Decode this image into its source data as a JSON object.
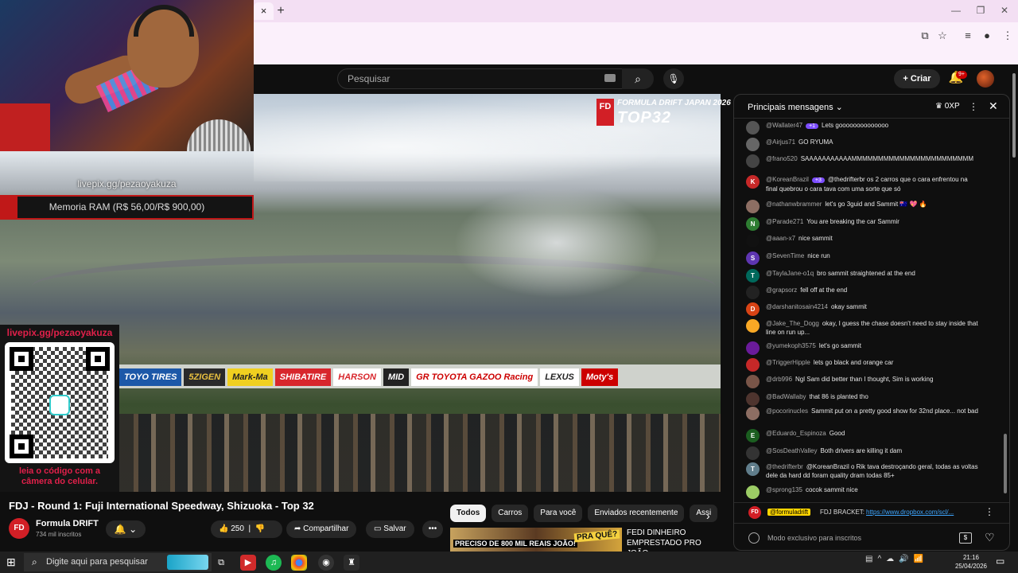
{
  "browser": {
    "tab_close": "×",
    "new_tab": "+",
    "min": "—",
    "max": "❐",
    "close": "✕"
  },
  "yt_header": {
    "search_placeholder": "Pesquisar",
    "create_label": "Criar",
    "bell_badge": "9+"
  },
  "video": {
    "overlay_brand": "FORMULA DRIFT JAPAN 2026",
    "overlay_tag": "TOP32",
    "fd_badge": "FD",
    "livepix_top": "livepix.gg/pezaoyakuza",
    "goal": "Memoria RAM (R$ 56,00/R$ 900,00)",
    "goal_progress": 0.062,
    "livepix_qr_label": "livepix.gg/pezaoyakuza",
    "qr_caption": "leia o código com a câmera do celular.",
    "banners": [
      "TOYO TIRES",
      "5ZIGEN",
      "Mark-Ma",
      "SHIBATIRE",
      "HARSON",
      "MID",
      "GR TOYOTA GAZOO Racing",
      "LEXUS",
      "Moty's"
    ]
  },
  "below": {
    "title": "FDJ - Round 1: Fuji International Speedway, Shizuoka - Top 32",
    "channel": "Formula DRIFT",
    "channel_avatar": "FD",
    "subs": "734 mil inscritos",
    "likes": "250",
    "share": "Compartilhar",
    "save": "Salvar",
    "more": "•••"
  },
  "chips": [
    "Todos",
    "Carros",
    "Para você",
    "Enviados recentemente",
    "Assi"
  ],
  "recommended": {
    "thumb_text": "PRECISO DE 800 MIL REAIS JOÃO!",
    "thumb_text2": "PRA QUÊ?",
    "title": "FEDI DINHEIRO EMPRESTADO PRO JOÃO ..."
  },
  "chat": {
    "title": "Principais mensagens",
    "xp": "0XP",
    "messages": [
      {
        "author": "@Wallater47",
        "badge": "+1",
        "text": "Lets goooooooooooooo",
        "color": "#555"
      },
      {
        "author": "@Airjus71",
        "text": "GO RYUMA",
        "color": "#666"
      },
      {
        "author": "@frano520",
        "text": "SAAAAAAAAAAAMMMMMMMMMMMMMMMMMMMMMMM",
        "color": "#444"
      },
      {
        "author": "@KoreanBrazil",
        "badge": "+3",
        "text": "@thedrifterbr os 2 carros que o cara enfrentou na final quebrou o cara tava com uma sorte que só",
        "color": "#c62828",
        "initial": "K"
      },
      {
        "author": "@nathanwbrammer",
        "text": "let's go 3guid and Sammit 🇦🇺 💖 🔥",
        "color": "#8d6e63"
      },
      {
        "author": "@Parade271",
        "text": "You are breaking the car Sammir",
        "color": "#2e7d32",
        "initial": "N"
      },
      {
        "author": "@aaan-x7",
        "text": "nice sammit",
        "color": "#111"
      },
      {
        "author": "@SevenTime",
        "text": "nice run",
        "color": "#5e35b1",
        "initial": "S"
      },
      {
        "author": "@TaylaJane-o1q",
        "text": "bro sammit straightened at the end",
        "color": "#00695c",
        "initial": "T"
      },
      {
        "author": "@grapsorz",
        "text": "fell off at the end",
        "color": "#222"
      },
      {
        "author": "@darshanitosain4214",
        "text": "okay sammit",
        "color": "#d84315",
        "initial": "D"
      },
      {
        "author": "@Jake_The_Dogg",
        "text": "okay, I guess the chase doesn't need to stay inside that line on run up...",
        "color": "#f9a825"
      },
      {
        "author": "@yumekoph3575",
        "text": "let's go sammit",
        "color": "#6a1b9a"
      },
      {
        "author": "@TriggerHipple",
        "text": "lets go black and orange car",
        "color": "#c62828"
      },
      {
        "author": "@drb996",
        "text": "Ngl Sam did better than I thought, Sim is working",
        "color": "#795548"
      },
      {
        "author": "@BadWallaby",
        "text": "that 86 is planted tho",
        "color": "#4e342e"
      },
      {
        "author": "@pocorinucles",
        "text": "Sammit put on a pretty good show for 32nd place... not bad",
        "color": "#8d6e63"
      },
      {
        "author": "@Eduardo_Espinoza",
        "text": "Good",
        "color": "#1b5e20",
        "initial": "E"
      },
      {
        "author": "@SosDeathValley",
        "text": "Both drivers are killing it dam",
        "color": "#333"
      },
      {
        "author": "@thedrifterbr",
        "text": "@KoreanBrazil o Rik tava destroçando geral, todas as voltas dele da hard dd foram quality dram todas 85+",
        "color": "#607d8b",
        "initial": "T"
      },
      {
        "author": "@sprong135",
        "text": "cocok sammit nice",
        "color": "#9ccc65"
      }
    ],
    "pinned_name": "@formuladrift",
    "pinned_text": "FDJ BRACKET:",
    "pinned_link": "https://www.dropbox.com/scl/...",
    "input_placeholder": "Modo exclusivo para inscritos"
  },
  "taskbar": {
    "search": "Digite aqui para pesquisar",
    "time": "21:16",
    "date": "25/04/2026"
  }
}
